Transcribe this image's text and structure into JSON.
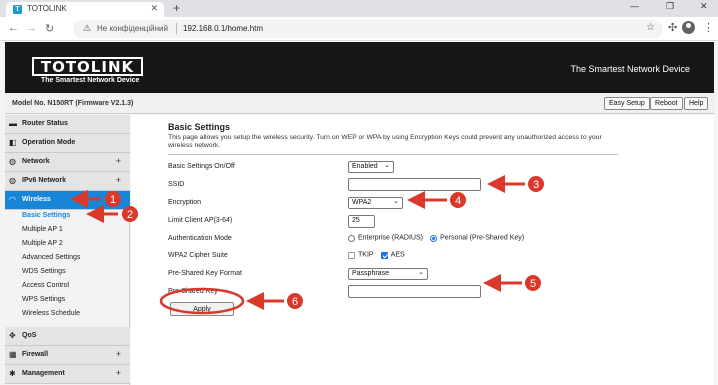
{
  "browser": {
    "tab_title": "TOTOLINK",
    "tab_favicon_letter": "T",
    "tab_close_glyph": "✕",
    "new_tab_glyph": "+",
    "window_controls": [
      "—",
      "❐",
      "✕"
    ],
    "nav_icons": [
      "back-icon",
      "forward-icon",
      "reload-icon"
    ],
    "not_secure_label": "Не конфіденційний",
    "url": "192.168.0.1/home.htm"
  },
  "header": {
    "logo_text": "TOTOLINK",
    "logo_tagline": "The Smartest Network Device",
    "banner_tagline": "The Smartest Network Device",
    "model": "Model No. N150RT (Firmware V2.1.3)",
    "buttons": [
      "Easy Setup",
      "Reboot",
      "Help"
    ]
  },
  "sidebar": {
    "items": [
      {
        "label": "Router Status",
        "icon": "router-status-icon",
        "glyph": "▬",
        "expand": ""
      },
      {
        "label": "Operation Mode",
        "icon": "operation-mode-icon",
        "glyph": "◧",
        "expand": ""
      },
      {
        "label": "Network",
        "icon": "network-icon",
        "glyph": "◍",
        "expand": "+"
      },
      {
        "label": "IPv6 Network",
        "icon": "ipv6-network-icon",
        "glyph": "◍",
        "expand": "+"
      },
      {
        "label": "Wireless",
        "icon": "wifi-icon",
        "glyph": "◠",
        "expand": ""
      },
      {
        "label": "QoS",
        "icon": "qos-icon",
        "glyph": "✥",
        "expand": ""
      },
      {
        "label": "Firewall",
        "icon": "firewall-icon",
        "glyph": "▦",
        "expand": "+"
      },
      {
        "label": "Management",
        "icon": "management-icon",
        "glyph": "✱",
        "expand": "+"
      }
    ],
    "wireless_sub": [
      "Basic Settings",
      "Multiple AP 1",
      "Multiple AP 2",
      "Advanced Settings",
      "WDS Settings",
      "Access Control",
      "WPS Settings",
      "Wireless Schedule"
    ]
  },
  "main": {
    "title": "Basic Settings",
    "description": "This page allows you setup the wireless security. Turn on WEP or WPA by using Encryption Keys could prevent any unauthorized access to your wireless network.",
    "fields": {
      "on_off": {
        "label": "Basic Settings On/Off",
        "value": "Enabled"
      },
      "ssid": {
        "label": "SSID",
        "value": ""
      },
      "encryption": {
        "label": "Encryption",
        "value": "WPA2"
      },
      "limit_client": {
        "label": "Limit Client AP(3-64)",
        "value": "25"
      },
      "auth_mode": {
        "label": "Authentication Mode",
        "options": [
          "Enterprise (RADIUS)",
          "Personal (Pre-Shared Key)"
        ],
        "selected": 1
      },
      "cipher": {
        "label": "WPA2 Cipher Suite",
        "options": [
          "TKIP",
          "AES"
        ],
        "checked": [
          false,
          true
        ]
      },
      "psk_format": {
        "label": "Pre-Shared Key Format",
        "value": "Passphrase"
      },
      "psk": {
        "label": "Pre-Shared Key",
        "value": ""
      }
    },
    "apply_label": "Apply"
  },
  "annotations": {
    "color": "#d9392b",
    "numbers": [
      "1",
      "2",
      "3",
      "4",
      "5",
      "6"
    ]
  }
}
